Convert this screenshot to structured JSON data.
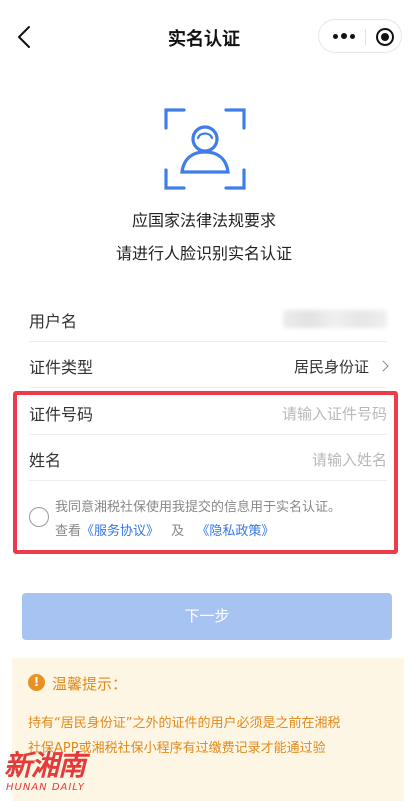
{
  "nav": {
    "title": "实名认证"
  },
  "hint": {
    "line1": "应国家法律法规要求",
    "line2": "请进行人脸识别实名认证"
  },
  "form": {
    "username_label": "用户名",
    "id_type_label": "证件类型",
    "id_type_value": "居民身份证",
    "id_number_label": "证件号码",
    "id_number_placeholder": "请输入证件号码",
    "name_label": "姓名",
    "name_placeholder": "请输入姓名"
  },
  "agreement": {
    "line1": "我同意湘税社保使用我提交的信息用于实名认证。",
    "view_text": "查看",
    "service_link": "《服务协议》",
    "and_text": "及",
    "privacy_link": "《隐私政策》"
  },
  "next_button": "下一步",
  "tips": {
    "icon": "!",
    "title": "温馨提示：",
    "line1": "持有“居民身份证”之外的证件的用户必须是之前在湘税",
    "line2": "社保APP或湘税社保小程序有过缴费记录才能通过验"
  },
  "watermark": {
    "main": "新湘南",
    "sub": "HUNAN DAILY"
  },
  "colors": {
    "accent_blue": "#3478e6",
    "button_disabled": "#a7c3f2",
    "highlight_red": "#ee3b4c",
    "tip_orange": "#e08a1e",
    "tip_bg": "#fdf6e4"
  },
  "icons": [
    "back-arrow-icon",
    "more-dots-icon",
    "target-icon",
    "face-scan-icon",
    "chevron-right-icon",
    "info-icon"
  ]
}
